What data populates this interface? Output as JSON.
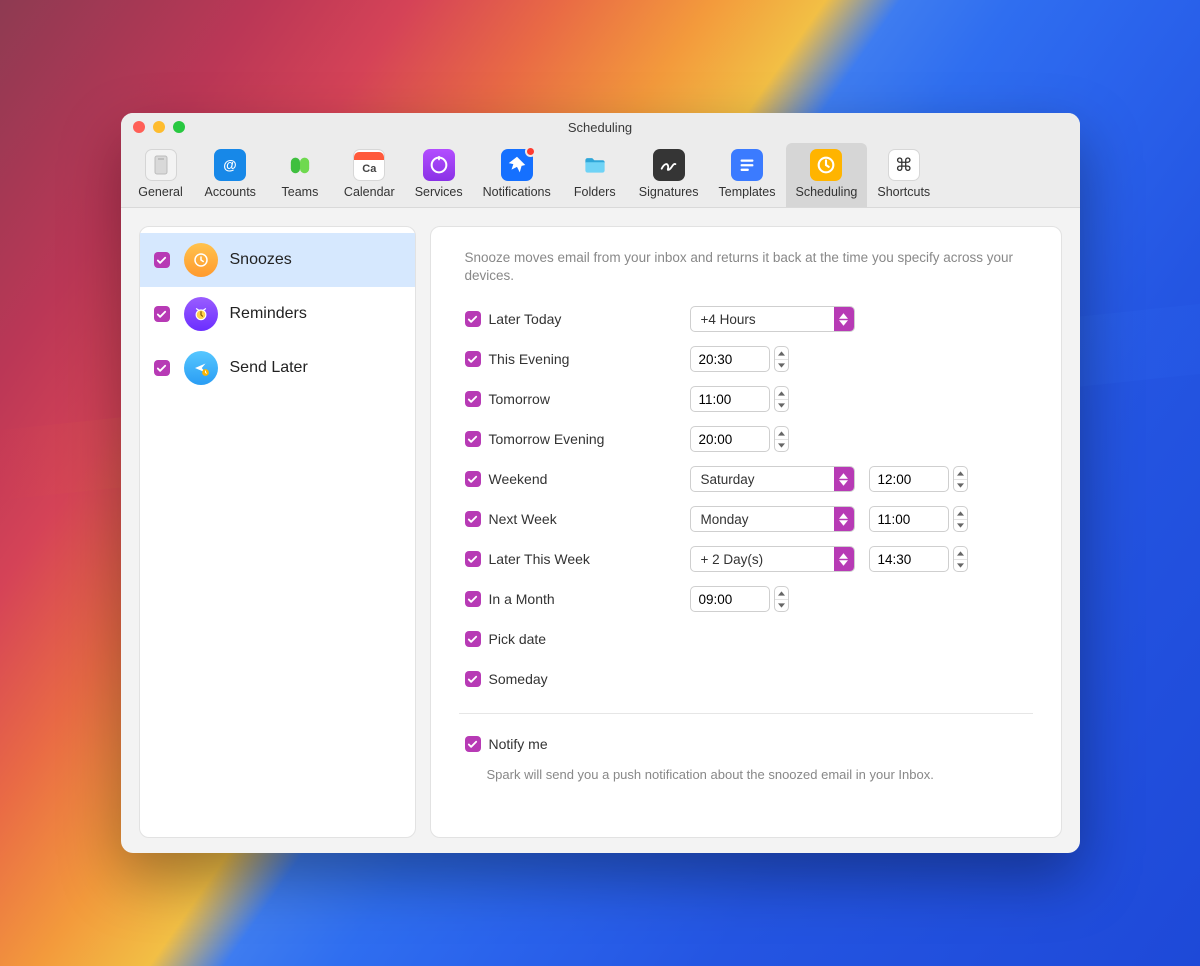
{
  "window": {
    "title": "Scheduling"
  },
  "toolbar": [
    {
      "id": "general",
      "label": "General"
    },
    {
      "id": "accounts",
      "label": "Accounts"
    },
    {
      "id": "teams",
      "label": "Teams"
    },
    {
      "id": "calendar",
      "label": "Calendar"
    },
    {
      "id": "services",
      "label": "Services"
    },
    {
      "id": "notifications",
      "label": "Notifications"
    },
    {
      "id": "folders",
      "label": "Folders"
    },
    {
      "id": "signatures",
      "label": "Signatures"
    },
    {
      "id": "templates",
      "label": "Templates"
    },
    {
      "id": "scheduling",
      "label": "Scheduling",
      "selected": true
    },
    {
      "id": "shortcuts",
      "label": "Shortcuts"
    }
  ],
  "sidebar": {
    "items": [
      {
        "id": "snoozes",
        "label": "Snoozes",
        "checked": true,
        "selected": true
      },
      {
        "id": "reminders",
        "label": "Reminders",
        "checked": true
      },
      {
        "id": "sendlater",
        "label": "Send Later",
        "checked": true
      }
    ]
  },
  "panel": {
    "description": "Snooze moves email from your inbox and returns it back at the time you specify across your devices.",
    "rows": [
      {
        "id": "later-today",
        "label": "Later Today",
        "checked": true,
        "dropdown": "+4 Hours"
      },
      {
        "id": "this-evening",
        "label": "This Evening",
        "checked": true,
        "time": "20:30"
      },
      {
        "id": "tomorrow",
        "label": "Tomorrow",
        "checked": true,
        "time": "11:00"
      },
      {
        "id": "tomorrow-evening",
        "label": "Tomorrow Evening",
        "checked": true,
        "time": "20:00"
      },
      {
        "id": "weekend",
        "label": "Weekend",
        "checked": true,
        "dropdown": "Saturday",
        "time": "12:00"
      },
      {
        "id": "next-week",
        "label": "Next Week",
        "checked": true,
        "dropdown": "Monday",
        "time": "11:00"
      },
      {
        "id": "later-this-week",
        "label": "Later This Week",
        "checked": true,
        "dropdown": "+ 2 Day(s)",
        "time": "14:30"
      },
      {
        "id": "in-a-month",
        "label": "In a Month",
        "checked": true,
        "time": "09:00"
      },
      {
        "id": "pick-date",
        "label": "Pick date",
        "checked": true
      },
      {
        "id": "someday",
        "label": "Someday",
        "checked": true
      }
    ],
    "notify": {
      "label": "Notify me",
      "checked": true,
      "description": "Spark will send you a push notification about the snoozed email in your Inbox."
    },
    "calendar_icon_text": "Ca"
  }
}
